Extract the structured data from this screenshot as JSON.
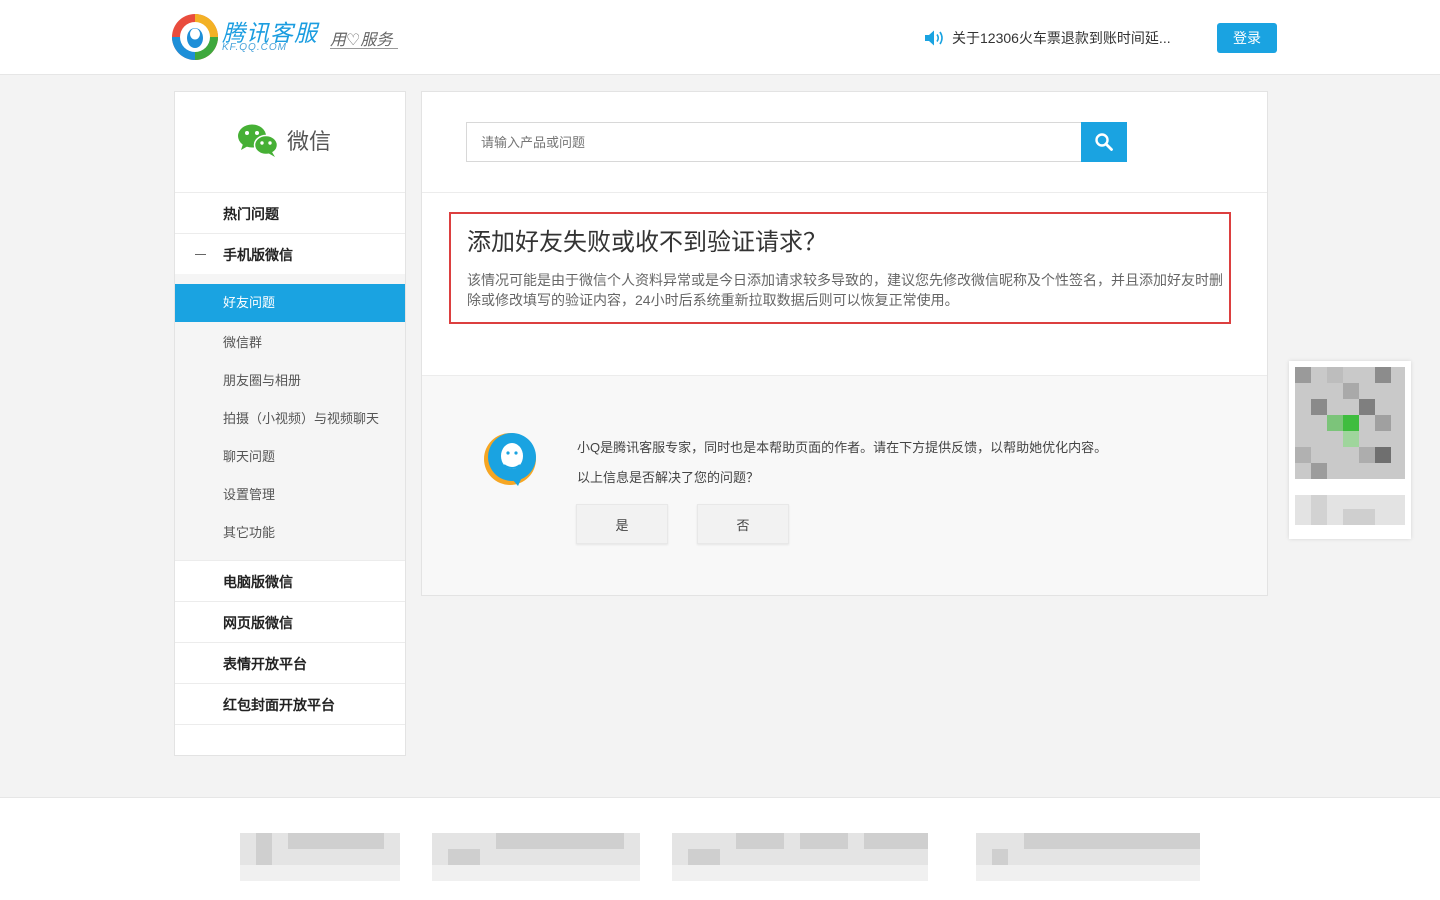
{
  "header": {
    "logo_text": "腾讯客服",
    "logo_sub": "KF.QQ.COM",
    "slogan": "用♡服务",
    "notice_text": "关于12306火车票退款到账时间延...",
    "login_label": "登录"
  },
  "sidebar": {
    "product_name": "微信",
    "categories_top": [
      {
        "label": "热门问题"
      },
      {
        "label": "手机版微信"
      }
    ],
    "subitems": [
      {
        "label": "好友问题"
      },
      {
        "label": "微信群"
      },
      {
        "label": "朋友圈与相册"
      },
      {
        "label": "拍摄（小视频）与视频聊天"
      },
      {
        "label": "聊天问题"
      },
      {
        "label": "设置管理"
      },
      {
        "label": "其它功能"
      }
    ],
    "categories_bottom": [
      {
        "label": "电脑版微信"
      },
      {
        "label": "网页版微信"
      },
      {
        "label": "表情开放平台"
      },
      {
        "label": "红包封面开放平台"
      }
    ]
  },
  "search": {
    "placeholder": "请输入产品或问题"
  },
  "answer": {
    "title": "添加好友失败或收不到验证请求？",
    "body": "该情况可能是由于微信个人资料异常或是今日添加请求较多导致的，建议您先修改微信昵称及个性签名，并且添加好友时删除或修改填写的验证内容，24小时后系统重新拉取数据后则可以恢复正常使用。"
  },
  "feedback": {
    "intro": "小Q是腾讯客服专家，同时也是本帮助页面的作者。请在下方提供反馈，以帮助她优化内容。",
    "question": "以上信息是否解决了您的问题？",
    "yes_label": "是",
    "no_label": "否"
  },
  "colors": {
    "accent": "#1aa3e1",
    "highlight_border": "#dc3f3f"
  }
}
